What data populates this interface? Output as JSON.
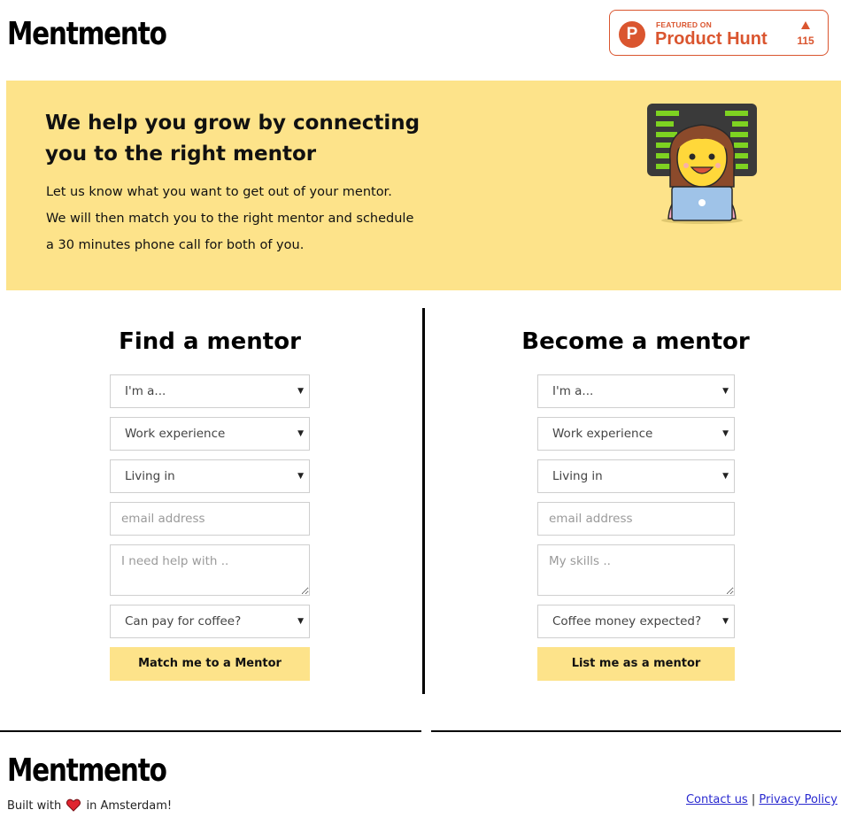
{
  "header": {
    "logo": "Mentmento",
    "product_hunt": {
      "featured_label": "FEATURED ON",
      "name": "Product Hunt",
      "logo_letter": "P",
      "votes": "115",
      "color": "#da552f"
    }
  },
  "hero": {
    "title": "We help you grow by connecting you to the right mentor",
    "lines": [
      "Let us know what you want to get out of your mentor.",
      "We will then match you to the right mentor and schedule",
      "a 30 minutes phone call for both of you."
    ],
    "background": "#fde38a",
    "illustration": "woman-at-laptop-icon"
  },
  "find_mentor": {
    "title": "Find a mentor",
    "role_select": "I'm a...",
    "experience_select": "Work experience",
    "location_select": "Living in",
    "email_placeholder": "email address",
    "help_placeholder": "I need help with ..",
    "coffee_select": "Can pay for coffee?",
    "submit_label": "Match me to a Mentor"
  },
  "become_mentor": {
    "title": "Become a mentor",
    "role_select": "I'm a...",
    "experience_select": "Work experience",
    "location_select": "Living in",
    "email_placeholder": "email address",
    "skills_placeholder": "My skills ..",
    "coffee_select": "Coffee money expected?",
    "submit_label": "List me as a mentor"
  },
  "footer": {
    "logo": "Mentmento",
    "built_prefix": "Built with",
    "built_suffix": "in Amsterdam!",
    "contact_label": "Contact us",
    "separator": "|",
    "privacy_label": "Privacy Policy"
  }
}
